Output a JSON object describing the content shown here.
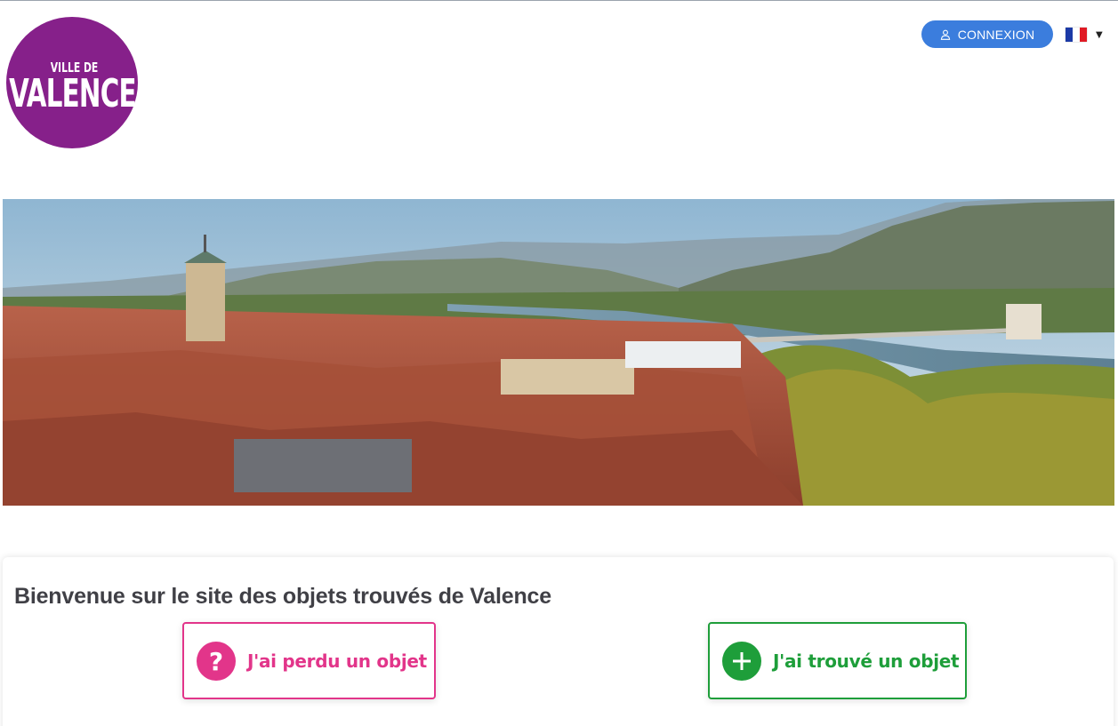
{
  "header": {
    "logo": {
      "line1": "VILLE DE",
      "line2": "VALENCE"
    },
    "login_label": "CONNEXION",
    "language": {
      "selected": "Français",
      "flag_colors": [
        "#1c3aa6",
        "#ffffff",
        "#e01a24"
      ]
    }
  },
  "banner": {
    "alt": "Vue panoramique de Valence"
  },
  "main": {
    "title": "Bienvenue sur le site des objets trouvés de Valence",
    "actions": [
      {
        "label": "J'ai perdu un objet",
        "icon": "question-icon",
        "color": "#e2358a"
      },
      {
        "label": "J'ai trouvé un objet",
        "icon": "plus-icon",
        "color": "#1e9e3a"
      }
    ]
  },
  "colors": {
    "brand": "#86208a",
    "primary": "#3b7ddd"
  }
}
